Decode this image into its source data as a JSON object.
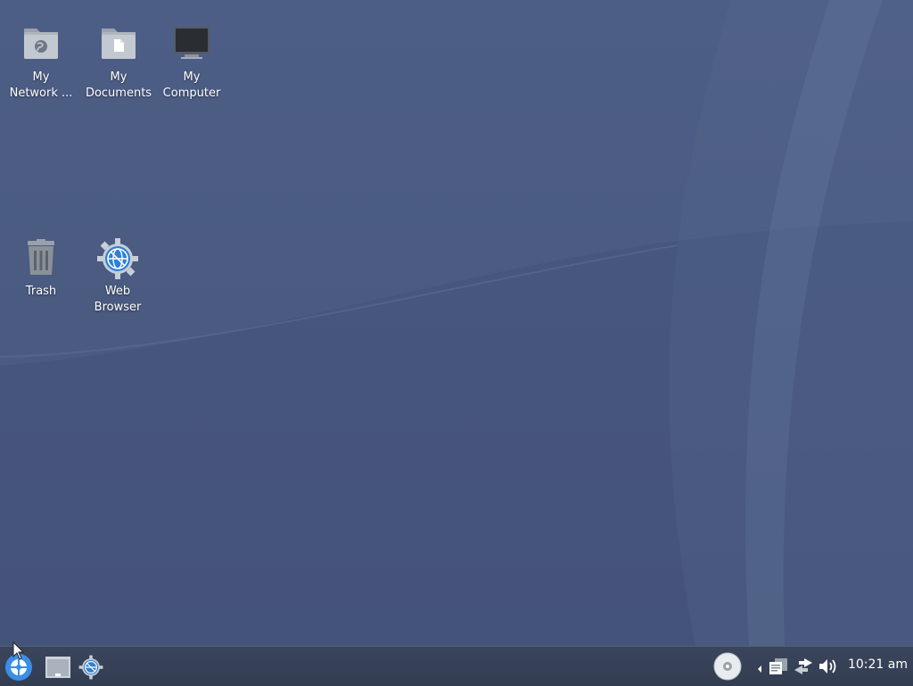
{
  "desktop": {
    "icons": [
      {
        "id": "network",
        "label": "My\nNetwork ...",
        "line1": "My",
        "line2": "Network ...",
        "icon": "network-folder-icon"
      },
      {
        "id": "documents",
        "label": "My Documents",
        "line1": "My",
        "line2": "Documents",
        "icon": "documents-folder-icon"
      },
      {
        "id": "computer",
        "label": "My Computer",
        "line1": "My",
        "line2": "Computer",
        "icon": "monitor-icon"
      },
      {
        "id": "trash",
        "line1": "Trash",
        "line2": "",
        "icon": "trash-icon"
      },
      {
        "id": "browser",
        "line1": "Web",
        "line2": "Browser",
        "icon": "web-browser-icon"
      }
    ]
  },
  "taskbar": {
    "start_icon": "start-menu-icon",
    "quicklaunch": [
      "show-desktop-icon",
      "web-browser-icon"
    ],
    "tray": [
      "optical-disc-icon",
      "tray-expand-arrow-icon",
      "clipboard-icon",
      "network-icon",
      "volume-icon"
    ],
    "clock": "10:21 am"
  },
  "colors": {
    "wallpaper": "#4a5b80",
    "taskbar": "#353f55",
    "accent": "#3a8ee6"
  }
}
